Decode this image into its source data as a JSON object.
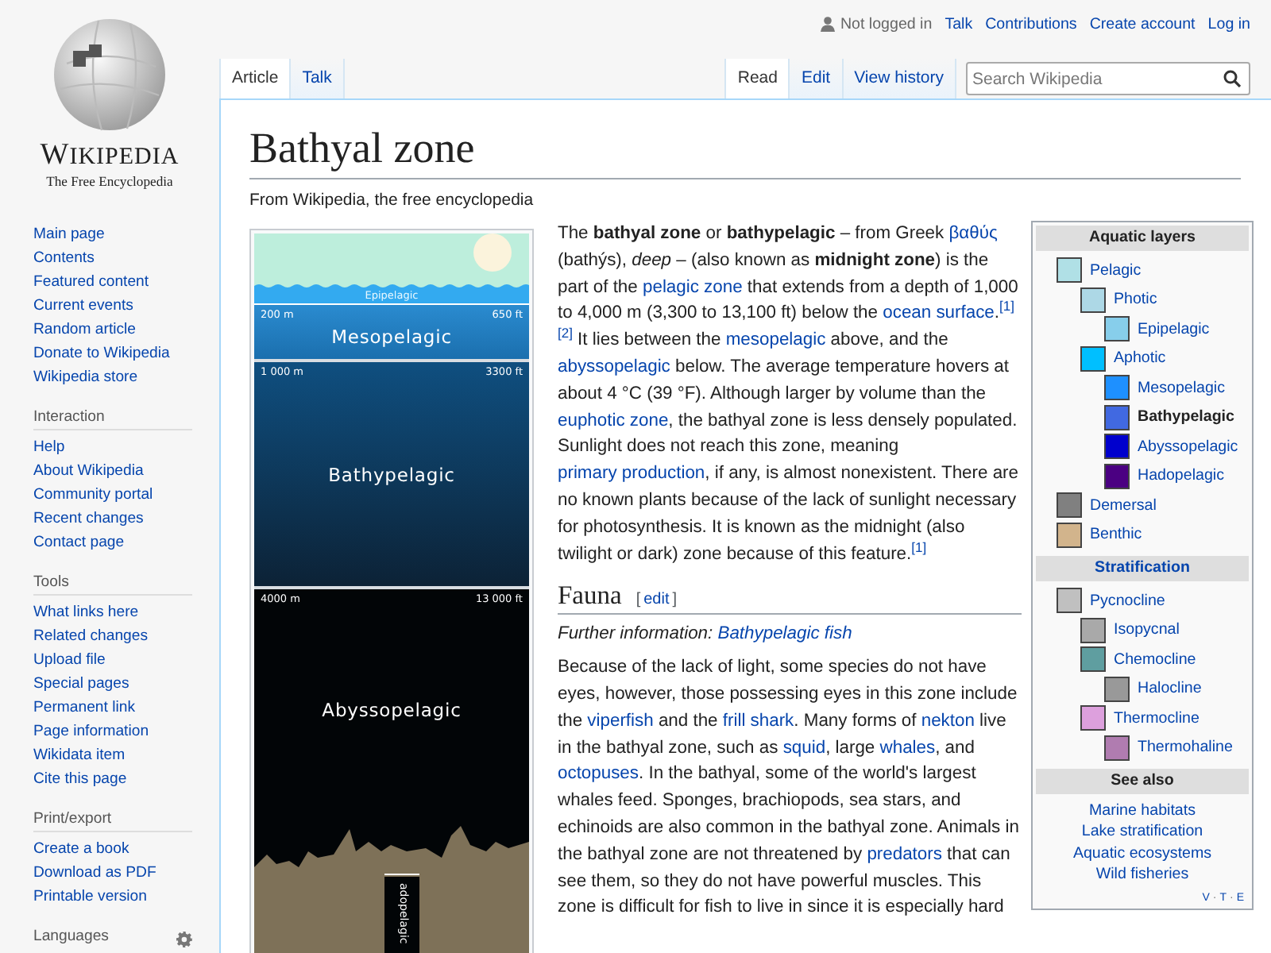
{
  "logo": {
    "wordmark": "WIKIPEDIA",
    "tagline": "The Free Encyclopedia"
  },
  "personal_tools": {
    "status": "Not logged in",
    "links": [
      "Talk",
      "Contributions",
      "Create account",
      "Log in"
    ]
  },
  "namespace_tabs": [
    {
      "label": "Article",
      "selected": true
    },
    {
      "label": "Talk",
      "selected": false
    }
  ],
  "view_tabs": [
    {
      "label": "Read",
      "selected": true
    },
    {
      "label": "Edit",
      "selected": false
    },
    {
      "label": "View history",
      "selected": false
    }
  ],
  "search": {
    "placeholder": "Search Wikipedia"
  },
  "sidebar": {
    "main_links": [
      "Main page",
      "Contents",
      "Featured content",
      "Current events",
      "Random article",
      "Donate to Wikipedia",
      "Wikipedia store"
    ],
    "portals": [
      {
        "heading": "Interaction",
        "links": [
          "Help",
          "About Wikipedia",
          "Community portal",
          "Recent changes",
          "Contact page"
        ]
      },
      {
        "heading": "Tools",
        "links": [
          "What links here",
          "Related changes",
          "Upload file",
          "Special pages",
          "Permanent link",
          "Page information",
          "Wikidata item",
          "Cite this page"
        ]
      },
      {
        "heading": "Print/export",
        "links": [
          "Create a book",
          "Download as PDF",
          "Printable version"
        ]
      }
    ],
    "languages_heading": "Languages"
  },
  "article": {
    "title": "Bathyal zone",
    "tagline": "From Wikipedia, the free encyclopedia",
    "figure": {
      "zones": [
        {
          "kind": "surface",
          "label": "Epipelagic"
        },
        {
          "kind": "upper",
          "label": "Mesopelagic",
          "top_m": "200 m",
          "top_ft": "650 ft"
        },
        {
          "kind": "middle",
          "label": "Bathypelagic",
          "top_m": "1 000 m",
          "top_ft": "3300 ft"
        },
        {
          "kind": "floor",
          "label": "Abyssopelagic",
          "top_m": "4000 m",
          "top_ft": "13 000 ft",
          "trench_label": "adopelagic"
        }
      ]
    },
    "intro": [
      {
        "kind": "text",
        "text": "The **bathyal zone** or **bathypelagic** – from Greek "
      },
      {
        "kind": "link",
        "text": "βαθύς"
      },
      {
        "kind": "text",
        "text": " (bathýs), *deep* – (also known as **midnight zone**) is the part of the "
      },
      {
        "kind": "link",
        "text": "pelagic zone"
      },
      {
        "kind": "text",
        "text": " that extends from a depth of 1,000 to 4,000 m (3,300 to 13,100 ft) below the "
      },
      {
        "kind": "link",
        "text": "ocean surface"
      },
      {
        "kind": "text",
        "text": "."
      },
      {
        "kind": "ref",
        "text": "[1]"
      },
      {
        "kind": "ref",
        "text": "[2]"
      },
      {
        "kind": "text",
        "text": " It lies between the "
      },
      {
        "kind": "link",
        "text": "mesopelagic"
      },
      {
        "kind": "text",
        "text": " above, and the "
      },
      {
        "kind": "link",
        "text": "abyssopelagic"
      },
      {
        "kind": "text",
        "text": " below. The average temperature hovers at about 4 °C (39 °F). Although larger by volume than the "
      },
      {
        "kind": "link",
        "text": "euphotic zone"
      },
      {
        "kind": "text",
        "text": ", the bathyal zone is less densely populated. Sunlight does not reach this zone, meaning "
      },
      {
        "kind": "link",
        "text": "primary production"
      },
      {
        "kind": "text",
        "text": ", if any, is almost nonexistent. There are no known plants because of the lack of sunlight necessary for photosynthesis. It is known as the midnight (also twilight or dark) zone because of this feature."
      },
      {
        "kind": "ref",
        "text": "[1]"
      }
    ],
    "sections": [
      {
        "heading": "Fauna",
        "edit": {
          "open": "[",
          "label": "edit",
          "close": "]"
        },
        "hatnote": {
          "prefix": "Further information: ",
          "link": "Bathypelagic fish"
        },
        "paragraph": [
          {
            "kind": "text",
            "text": "Because of the lack of light, some species do not have eyes, however, those possessing eyes in this zone include the "
          },
          {
            "kind": "link",
            "text": "viperfish"
          },
          {
            "kind": "text",
            "text": " and the "
          },
          {
            "kind": "link",
            "text": "frill shark"
          },
          {
            "kind": "text",
            "text": ". Many forms of "
          },
          {
            "kind": "link",
            "text": "nekton"
          },
          {
            "kind": "text",
            "text": " live in the bathyal zone, such as "
          },
          {
            "kind": "link",
            "text": "squid"
          },
          {
            "kind": "text",
            "text": ", large "
          },
          {
            "kind": "link",
            "text": "whales"
          },
          {
            "kind": "text",
            "text": ", and "
          },
          {
            "kind": "link",
            "text": "octopuses"
          },
          {
            "kind": "text",
            "text": ". In the bathyal, some of the world's largest whales feed. Sponges, brachiopods, sea stars, and echinoids are also common in the bathyal zone. Animals in the bathyal zone are not threatened by "
          },
          {
            "kind": "link",
            "text": "predators"
          },
          {
            "kind": "text",
            "text": " that can see them, so they do not have powerful muscles. This zone is difficult for fish to live in since it is especially hard"
          }
        ]
      }
    ]
  },
  "navbox": {
    "sections": [
      {
        "title": "Aquatic layers",
        "title_link": false,
        "kind": "tree",
        "items": [
          {
            "label": "Pelagic",
            "color": "#b0e0e6",
            "selected": false,
            "children": [
              {
                "label": "Photic",
                "color": "#add8e6",
                "selected": false,
                "children": [
                  {
                    "label": "Epipelagic",
                    "color": "#87ceeb",
                    "selected": false
                  }
                ]
              },
              {
                "label": "Aphotic",
                "color": "#00bfff",
                "selected": false,
                "children": [
                  {
                    "label": "Mesopelagic",
                    "color": "#1e90ff",
                    "selected": false
                  },
                  {
                    "label": "Bathypelagic",
                    "color": "#4169e1",
                    "selected": true
                  },
                  {
                    "label": "Abyssopelagic",
                    "color": "#0000cd",
                    "selected": false
                  },
                  {
                    "label": "Hadopelagic",
                    "color": "#4b0082",
                    "selected": false
                  }
                ]
              }
            ]
          },
          {
            "label": "Demersal",
            "color": "#808080",
            "selected": false
          },
          {
            "label": "Benthic",
            "color": "#d2b48c",
            "selected": false
          }
        ]
      },
      {
        "title": "Stratification",
        "title_link": true,
        "kind": "tree",
        "items": [
          {
            "label": "Pycnocline",
            "color": "#c0c0c0",
            "selected": false,
            "children": [
              {
                "label": "Isopycnal",
                "color": "#a9a9a9",
                "selected": false
              },
              {
                "label": "Chemocline",
                "color": "#5f9ea0",
                "selected": false,
                "children": [
                  {
                    "label": "Halocline",
                    "color": "#999999",
                    "selected": false
                  }
                ]
              },
              {
                "label": "Thermocline",
                "color": "#dda0dd",
                "selected": false,
                "children": [
                  {
                    "label": "Thermohaline",
                    "color": "#b07cb0",
                    "selected": false
                  }
                ]
              }
            ]
          }
        ]
      },
      {
        "title": "See also",
        "title_link": false,
        "kind": "list",
        "items": [
          {
            "label": "Marine habitats"
          },
          {
            "label": "Lake stratification"
          },
          {
            "label": "Aquatic ecosystems"
          },
          {
            "label": "Wild fisheries"
          }
        ]
      }
    ],
    "footer": {
      "links": [
        "V",
        "T",
        "E"
      ],
      "separator": "·"
    }
  }
}
